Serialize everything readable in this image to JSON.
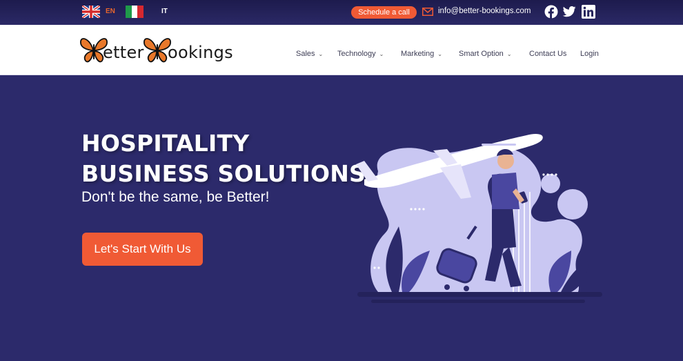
{
  "topbar": {
    "languages": [
      {
        "code": "EN",
        "flag": "uk-flag-icon"
      },
      {
        "code": "IT",
        "flag": "italy-flag-icon"
      }
    ],
    "schedule_label": "Schedule a call",
    "email": "info@better-bookings.com",
    "social_icons": [
      "facebook-icon",
      "twitter-icon",
      "linkedin-icon"
    ]
  },
  "logo": {
    "part1": "etter",
    "part2": "ookings"
  },
  "nav": {
    "items": [
      {
        "label": "Sales",
        "dropdown": true
      },
      {
        "label": "Technology",
        "dropdown": true
      },
      {
        "label": "Marketing",
        "dropdown": true
      },
      {
        "label": "Smart Option",
        "dropdown": true
      },
      {
        "label": "Contact Us",
        "dropdown": false
      },
      {
        "label": "Login",
        "dropdown": false
      }
    ]
  },
  "hero": {
    "title_line1": "HOSPITALITY",
    "title_line2": "BUSINESS SOLUTIONS",
    "subtitle": "Don't be the same, be Better!",
    "cta_label": "Let's Start With Us"
  },
  "colors": {
    "background": "#2c2a6b",
    "accent": "#f05a35",
    "lang_active": "#e8662d",
    "illustration_light": "#c9c7f2"
  }
}
